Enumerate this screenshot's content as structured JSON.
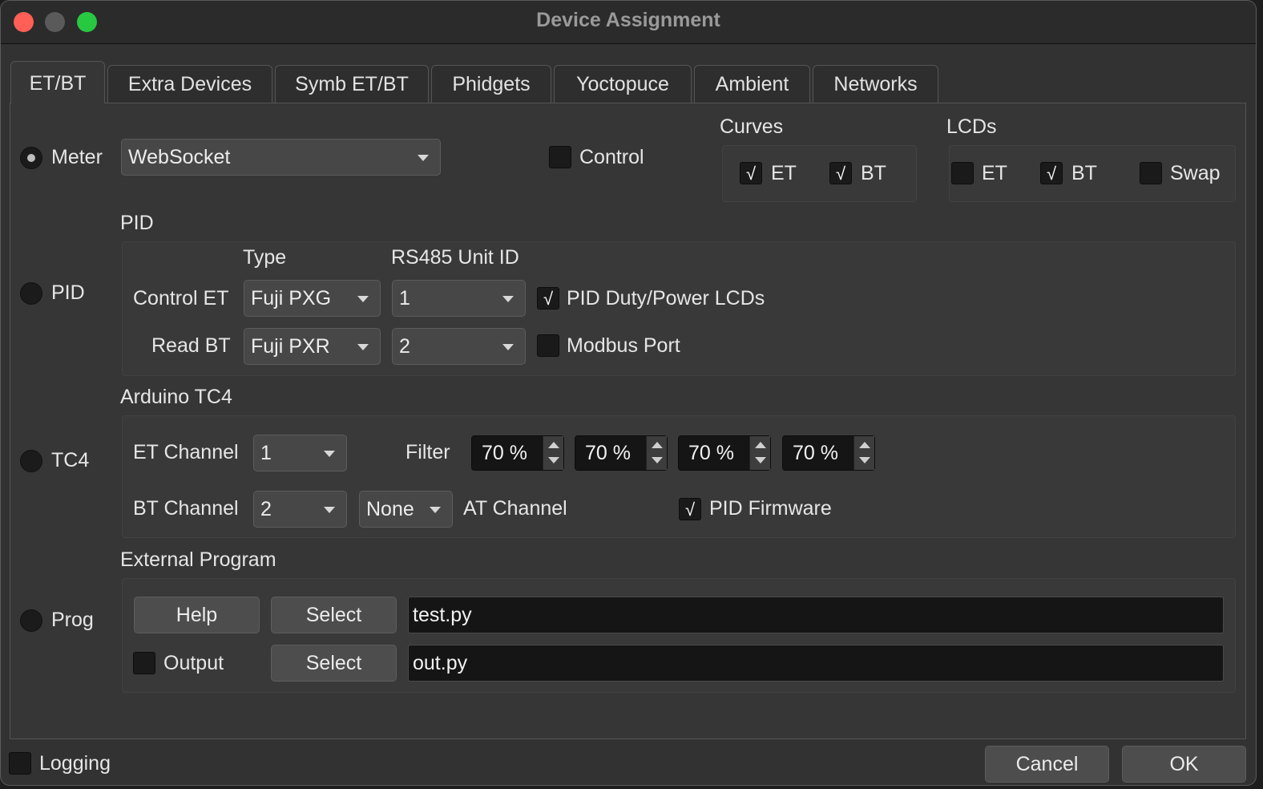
{
  "window": {
    "title": "Device Assignment"
  },
  "tabs": [
    {
      "label": "ET/BT",
      "active": true
    },
    {
      "label": "Extra Devices"
    },
    {
      "label": "Symb ET/BT"
    },
    {
      "label": "Phidgets"
    },
    {
      "label": "Yoctopuce"
    },
    {
      "label": "Ambient"
    },
    {
      "label": "Networks"
    }
  ],
  "sources": {
    "meter": {
      "label": "Meter",
      "selected": true
    },
    "pid": {
      "label": "PID",
      "selected": false
    },
    "tc4": {
      "label": "TC4",
      "selected": false
    },
    "prog": {
      "label": "Prog",
      "selected": false
    }
  },
  "meter": {
    "device": "WebSocket",
    "control_label": "Control",
    "control_checked": false
  },
  "curves": {
    "title": "Curves",
    "et_label": "ET",
    "et_checked": true,
    "bt_label": "BT",
    "bt_checked": true
  },
  "lcds": {
    "title": "LCDs",
    "et_label": "ET",
    "et_checked": false,
    "bt_label": "BT",
    "bt_checked": true,
    "swap_label": "Swap",
    "swap_checked": false
  },
  "pid": {
    "title": "PID",
    "type_header": "Type",
    "unit_header": "RS485 Unit ID",
    "control_et_label": "Control ET",
    "control_et_type": "Fuji PXG",
    "control_et_unit": "1",
    "read_bt_label": "Read BT",
    "read_bt_type": "Fuji PXR",
    "read_bt_unit": "2",
    "duty_lcds_label": "PID Duty/Power LCDs",
    "duty_lcds_checked": true,
    "modbus_port_label": "Modbus Port",
    "modbus_port_checked": false
  },
  "tc4": {
    "title": "Arduino TC4",
    "et_channel_label": "ET Channel",
    "et_channel": "1",
    "bt_channel_label": "BT Channel",
    "bt_channel": "2",
    "at_channel": "None",
    "at_channel_label": "AT Channel",
    "filter_label": "Filter",
    "filters": [
      "70 %",
      "70 %",
      "70 %",
      "70 %"
    ],
    "pid_firmware_label": "PID Firmware",
    "pid_firmware_checked": true
  },
  "external": {
    "title": "External Program",
    "help_label": "Help",
    "select_label": "Select",
    "program": "test.py",
    "output_label": "Output",
    "output_checked": false,
    "output_select_label": "Select",
    "output_program": "out.py"
  },
  "footer": {
    "logging_label": "Logging",
    "logging_checked": false,
    "cancel_label": "Cancel",
    "ok_label": "OK"
  },
  "icons": {
    "checkmark": "√"
  },
  "colors": {
    "close": "#ff5f57",
    "maximize": "#28c840",
    "panel_bg": "#363636",
    "field_bg": "#151515"
  }
}
